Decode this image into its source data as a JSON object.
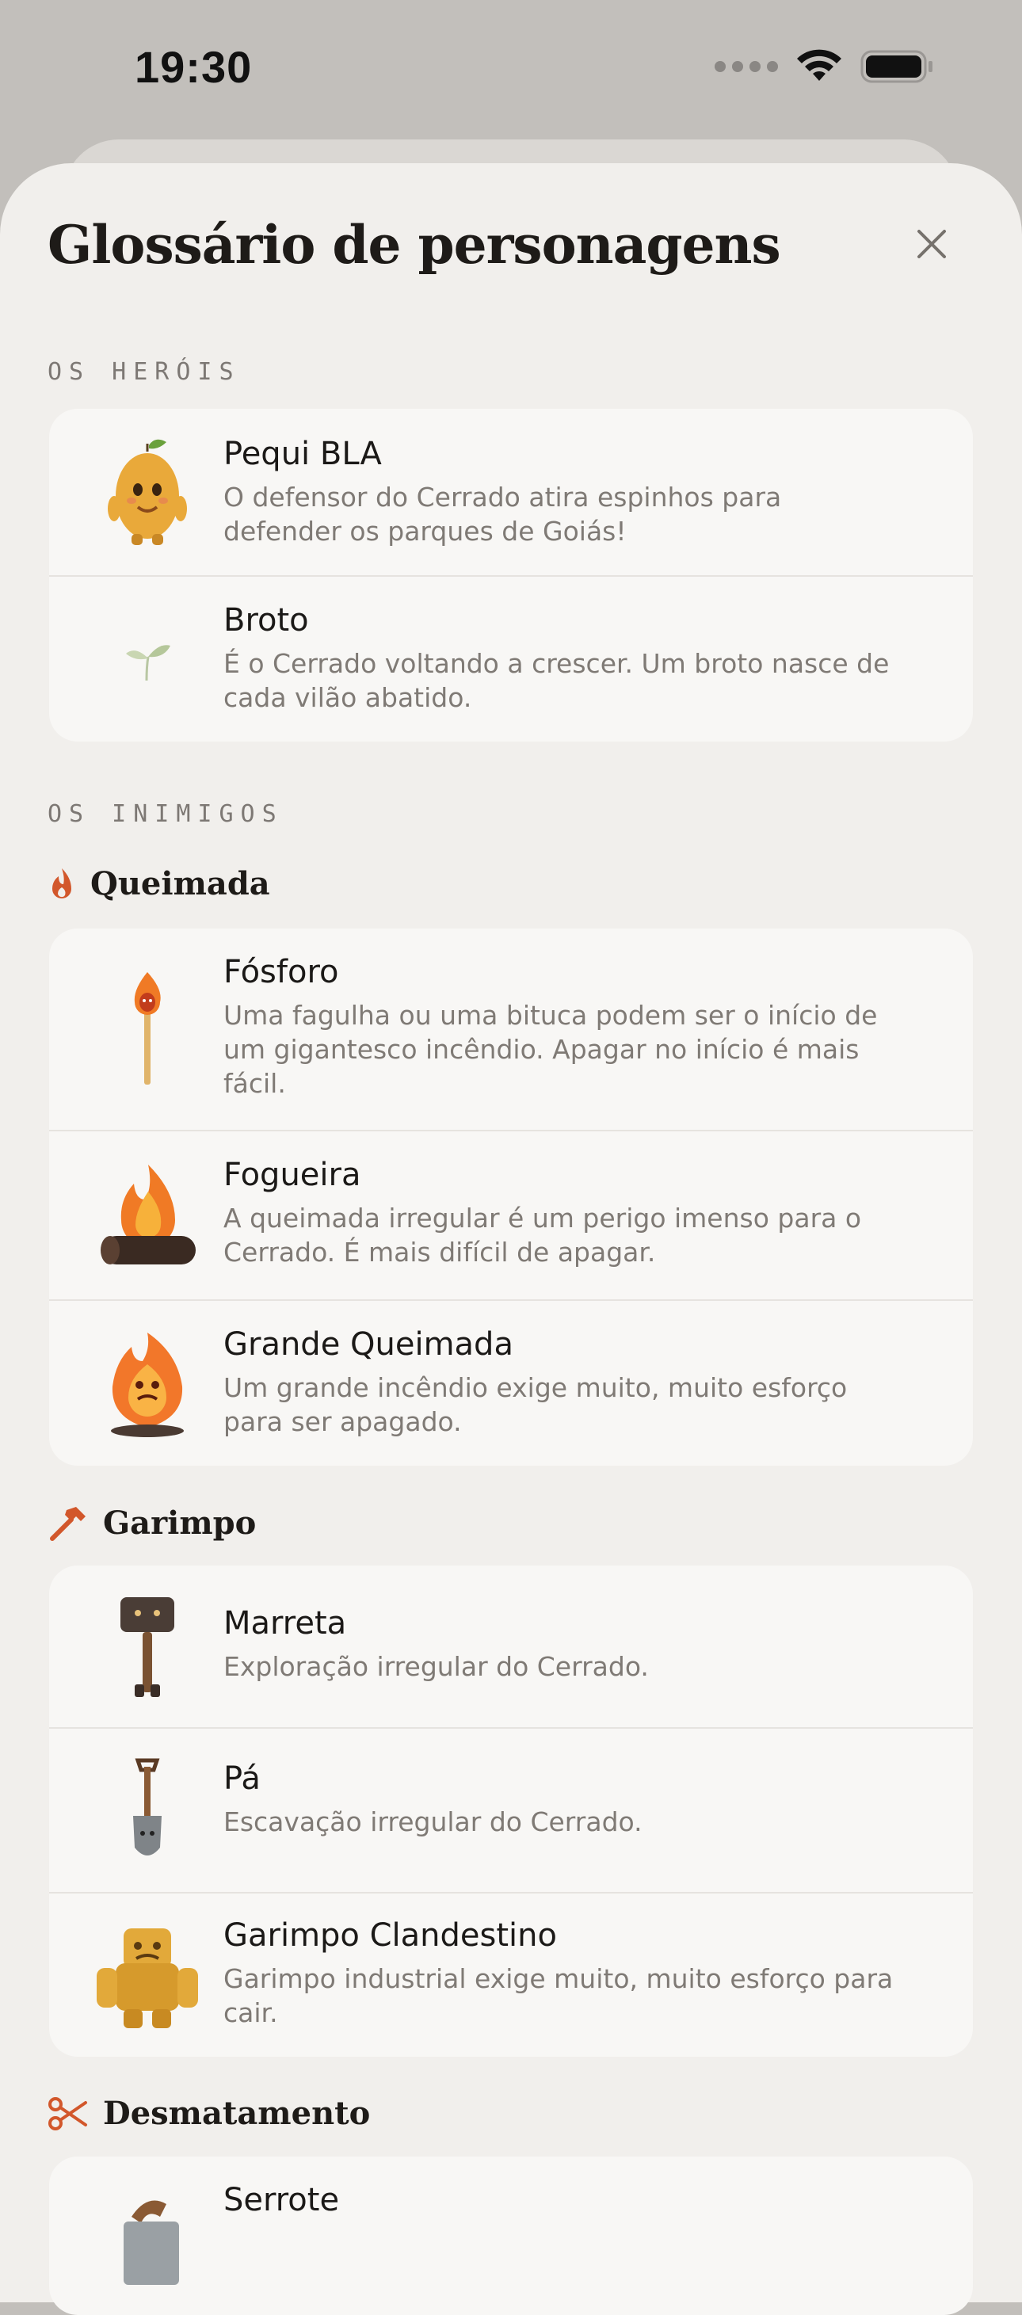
{
  "status": {
    "time": "19:30"
  },
  "sheet": {
    "title": "Glossário de personagens"
  },
  "heroes": {
    "label": "OS HERÓIS",
    "items": [
      {
        "name": "Pequi BLA",
        "desc": "O defensor do Cerrado atira espinhos para defender os parques de Goiás!",
        "icon": "pequi-character-icon"
      },
      {
        "name": "Broto",
        "desc": "É o Cerrado voltando a crescer. Um broto nasce de cada vilão abatido.",
        "icon": "sprout-icon"
      }
    ]
  },
  "enemies": {
    "label": "OS INIMIGOS",
    "groups": [
      {
        "title": "Queimada",
        "icon": "flame-icon",
        "color": "#d2572b",
        "items": [
          {
            "name": "Fósforo",
            "desc": "Uma fagulha ou uma bituca podem ser o início de um gigantesco incêndio. Apagar no início é mais fácil.",
            "icon": "match-character-icon"
          },
          {
            "name": "Fogueira",
            "desc": "A queimada irregular é um perigo imenso para o Cerrado. É mais difícil de apagar.",
            "icon": "bonfire-character-icon"
          },
          {
            "name": "Grande Queimada",
            "desc": "Um grande incêndio exige muito, muito esforço para ser apagado.",
            "icon": "wildfire-character-icon"
          }
        ]
      },
      {
        "title": "Garimpo",
        "icon": "hammer-icon",
        "color": "#d2572b",
        "items": [
          {
            "name": "Marreta",
            "desc": "Exploração irregular do Cerrado.",
            "icon": "sledgehammer-character-icon"
          },
          {
            "name": "Pá",
            "desc": "Escavação irregular do Cerrado.",
            "icon": "shovel-character-icon"
          },
          {
            "name": "Garimpo Clandestino",
            "desc": "Garimpo industrial exige muito, muito esforço para cair.",
            "icon": "gold-golem-character-icon"
          }
        ]
      },
      {
        "title": "Desmatamento",
        "icon": "scissors-icon",
        "color": "#d2572b",
        "items": [
          {
            "name": "Serrote",
            "desc": "",
            "icon": "saw-character-icon"
          }
        ]
      }
    ]
  }
}
